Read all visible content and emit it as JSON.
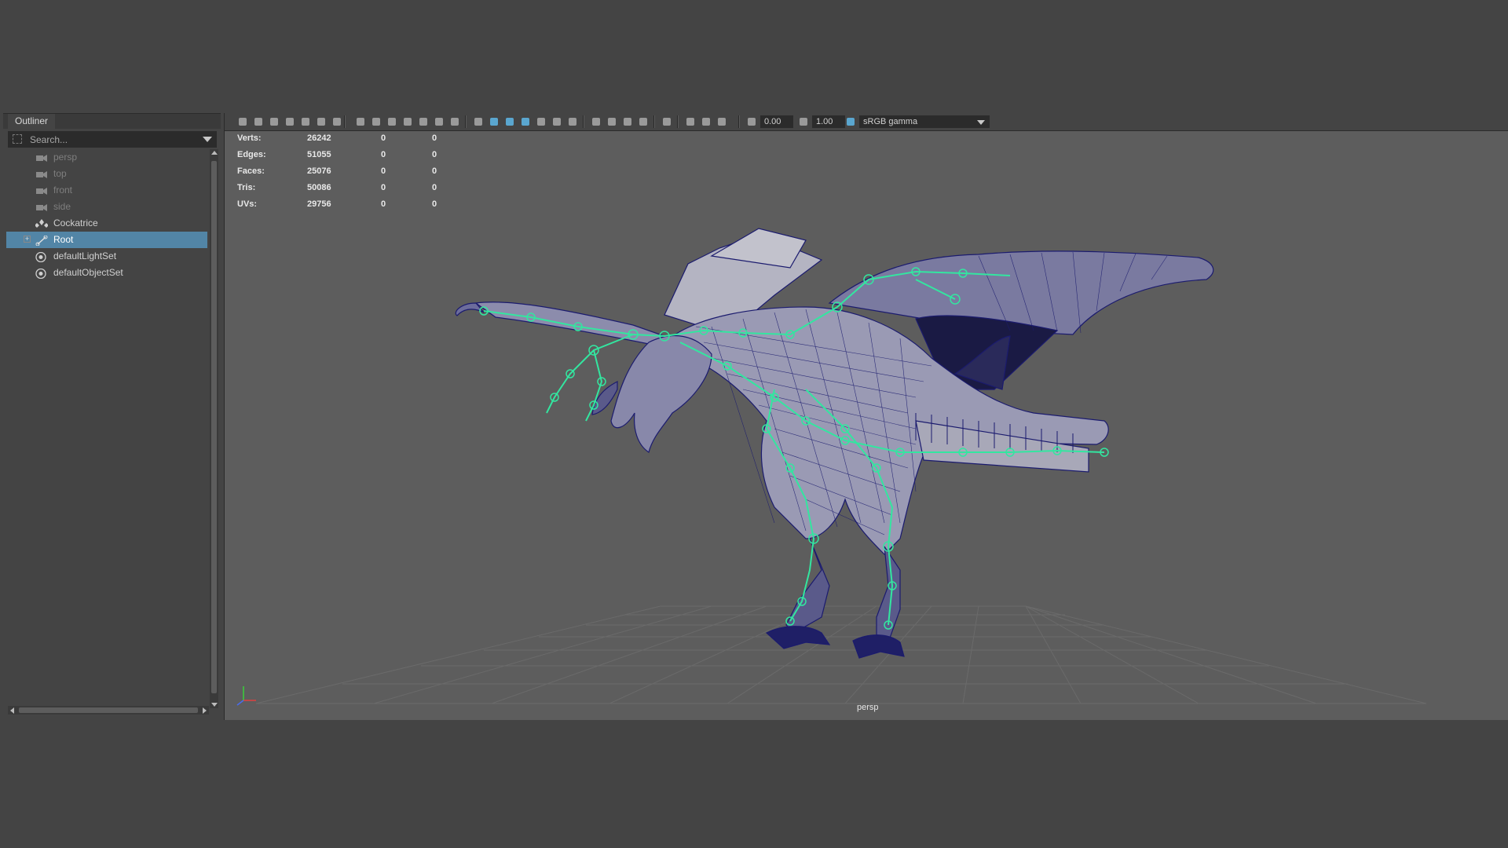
{
  "outliner": {
    "tab_label": "Outliner",
    "search_placeholder": "Search...",
    "items": [
      {
        "label": "persp",
        "icon": "camera-icon",
        "dim": true
      },
      {
        "label": "top",
        "icon": "camera-icon",
        "dim": true
      },
      {
        "label": "front",
        "icon": "camera-icon",
        "dim": true
      },
      {
        "label": "side",
        "icon": "camera-icon",
        "dim": true
      },
      {
        "label": "Cockatrice",
        "icon": "transform-group-icon",
        "dim": false
      },
      {
        "label": "Root",
        "icon": "joint-icon",
        "dim": false,
        "selected": true,
        "expandable": true
      },
      {
        "label": "defaultLightSet",
        "icon": "set-icon",
        "dim": false
      },
      {
        "label": "defaultObjectSet",
        "icon": "set-icon",
        "dim": false
      }
    ]
  },
  "viewport": {
    "camera_label": "persp",
    "exposure_value": "0.00",
    "gamma_value": "1.00",
    "color_space": "sRGB gamma",
    "stats": [
      {
        "label": "Verts:",
        "value": "26242",
        "sel": "0",
        "comp": "0"
      },
      {
        "label": "Edges:",
        "value": "51055",
        "sel": "0",
        "comp": "0"
      },
      {
        "label": "Faces:",
        "value": "25076",
        "sel": "0",
        "comp": "0"
      },
      {
        "label": "Tris:",
        "value": "50086",
        "sel": "0",
        "comp": "0"
      },
      {
        "label": "UVs:",
        "value": "29756",
        "sel": "0",
        "comp": "0"
      }
    ]
  },
  "colors": {
    "selection": "#5285a6",
    "viewport_bg": "#5d5d5d",
    "wireframe": "#1a1a66",
    "joints": "#33e6a0"
  }
}
